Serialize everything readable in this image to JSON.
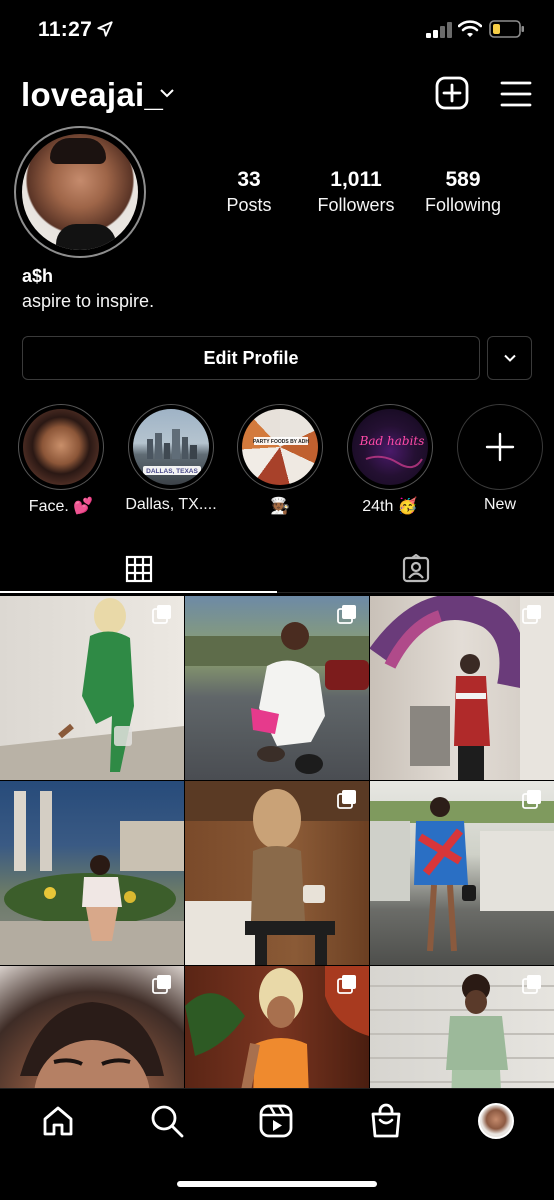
{
  "status_bar": {
    "time": "11:27",
    "icons": [
      "location-arrow-icon",
      "signal-icon",
      "wifi-icon",
      "battery-icon"
    ],
    "battery_color": "#f7ce46"
  },
  "header": {
    "username": "loveajai_",
    "icons": [
      "chevron-down-icon",
      "plus-square-icon",
      "hamburger-menu-icon"
    ]
  },
  "profile": {
    "stats": [
      {
        "value": "33",
        "label": "Posts"
      },
      {
        "value": "1,011",
        "label": "Followers"
      },
      {
        "value": "589",
        "label": "Following"
      }
    ],
    "display_name": "a$h",
    "bio": "aspire to inspire.",
    "edit_profile_label": "Edit Profile"
  },
  "highlights": [
    {
      "label": "Face. 💕"
    },
    {
      "label": "Dallas, TX...."
    },
    {
      "label": "🧑🏾‍🍳"
    },
    {
      "label": "24th 🥳"
    },
    {
      "label": "New"
    }
  ],
  "highlight_image_text": {
    "dallas": "DALLAS, TEXAS",
    "party": "PARTY FOODS BY ADH",
    "neon": "Bad habits"
  },
  "tabs": [
    "grid-tab",
    "tagged-tab"
  ],
  "posts": [
    {
      "type": "carousel",
      "colors": [
        "#e6e2dc",
        "#2f8a45",
        "#c9c3b6"
      ]
    },
    {
      "type": "carousel",
      "colors": [
        "#6d7b5e",
        "#f2f2f2",
        "#4a4d52"
      ]
    },
    {
      "type": "carousel",
      "colors": [
        "#d8d2cc",
        "#6a3b7a",
        "#b02a2a"
      ]
    },
    {
      "type": "photo",
      "colors": [
        "#274b7a",
        "#3c5e2b",
        "#ead7d2"
      ]
    },
    {
      "type": "carousel",
      "colors": [
        "#7a4a2a",
        "#8a6a4a",
        "#2a2a2a"
      ]
    },
    {
      "type": "carousel",
      "colors": [
        "#cfd1c8",
        "#2a6fc4",
        "#6b6c68"
      ]
    },
    {
      "type": "carousel",
      "colors": [
        "#4a3a33",
        "#b7876f",
        "#d8d0cb"
      ]
    },
    {
      "type": "carousel",
      "colors": [
        "#5a2515",
        "#ef8a2e",
        "#a83a1f"
      ]
    },
    {
      "type": "carousel",
      "colors": [
        "#d7d5d0",
        "#9cb99a",
        "#5c5a57"
      ]
    }
  ],
  "bottom_nav": [
    "home-icon",
    "search-icon",
    "reels-icon",
    "shop-icon",
    "profile-avatar"
  ]
}
